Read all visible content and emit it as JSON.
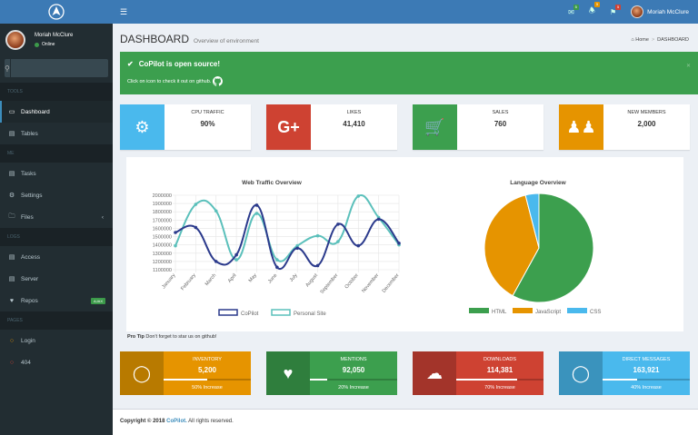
{
  "user": {
    "name": "Moriah McClure",
    "status": "Online"
  },
  "sidebar": {
    "search_placeholder": "",
    "sections": [
      {
        "header": "TOOLS",
        "items": [
          {
            "label": "Dashboard",
            "icon": "desktop-icon",
            "active": true
          },
          {
            "label": "Tables",
            "icon": "table-icon"
          }
        ]
      },
      {
        "header": "ME",
        "items": [
          {
            "label": "Tasks",
            "icon": "tasks-icon"
          },
          {
            "label": "Settings",
            "icon": "gear-icon"
          },
          {
            "label": "Files",
            "icon": "folder-icon",
            "chevron": "‹"
          }
        ]
      },
      {
        "header": "LOGS",
        "items": [
          {
            "label": "Access",
            "icon": "book-icon"
          },
          {
            "label": "Server",
            "icon": "server-icon"
          },
          {
            "label": "Repos",
            "icon": "heart-icon",
            "tag": "AJAX"
          }
        ]
      },
      {
        "header": "PAGES",
        "items": [
          {
            "label": "Login",
            "icon": "circle-icon",
            "color": "#e69400"
          },
          {
            "label": "404",
            "icon": "circle-icon",
            "color": "#d14234"
          }
        ]
      }
    ]
  },
  "topbar": {
    "badges": [
      {
        "icon": "envelope-icon",
        "count": "5",
        "color": "#3c9a4a"
      },
      {
        "icon": "bell-icon",
        "count": "5",
        "color": "#e69400"
      },
      {
        "icon": "flag-icon",
        "count": "5",
        "color": "#d14234"
      }
    ]
  },
  "header": {
    "title": "DASHBOARD",
    "subtitle": "Overview of environment",
    "breadcrumb": [
      "Home",
      "DASHBOARD"
    ]
  },
  "alert": {
    "title": "CoPilot is open source!",
    "text": "Click on icon to check it out on github."
  },
  "info_boxes": [
    {
      "label": "CPU TRAFFIC",
      "value": "90%",
      "color": "#4ab9ed",
      "icon": "gear-icon"
    },
    {
      "label": "LIKES",
      "value": "41,410",
      "color": "#ce4232",
      "icon": "google-plus-icon"
    },
    {
      "label": "SALES",
      "value": "760",
      "color": "#3c9f4e",
      "icon": "shopping-cart-icon"
    },
    {
      "label": "NEW MEMBERS",
      "value": "2,000",
      "color": "#e69400",
      "icon": "users-icon"
    }
  ],
  "chart_data": [
    {
      "type": "line",
      "title": "Web Traffic Overview",
      "categories": [
        "January",
        "February",
        "March",
        "April",
        "May",
        "June",
        "July",
        "August",
        "September",
        "October",
        "November",
        "December"
      ],
      "ylim": [
        1100000,
        2000000
      ],
      "yticks": [
        "2000000",
        "1900000",
        "1800000",
        "1700000",
        "1600000",
        "1500000",
        "1400000",
        "1300000",
        "1200000",
        "1100000"
      ],
      "grid": true,
      "legend": "bottom",
      "series": [
        {
          "name": "CoPilot",
          "color": "#2b3a8c",
          "values": [
            1550000,
            1610000,
            1200000,
            1280000,
            1880000,
            1130000,
            1360000,
            1150000,
            1650000,
            1390000,
            1710000,
            1420000
          ]
        },
        {
          "name": "Personal Site",
          "color": "#5bc0bb",
          "values": [
            1390000,
            1890000,
            1810000,
            1220000,
            1780000,
            1220000,
            1390000,
            1510000,
            1440000,
            1990000,
            1730000,
            1400000
          ]
        }
      ]
    },
    {
      "type": "pie",
      "title": "Language Overview",
      "legend": "bottom",
      "categories": [
        "HTML",
        "JavaScript",
        "CSS"
      ],
      "values": [
        58,
        38,
        4
      ],
      "colors": [
        "#3c9f4e",
        "#e69400",
        "#4ab9ed"
      ]
    }
  ],
  "protip": {
    "label": "Pro Tip",
    "text": "Don't forget to star us on github!"
  },
  "stat_boxes": [
    {
      "label": "INVENTORY",
      "value": "5,200",
      "desc": "50% Increase",
      "progress": 50,
      "color": "#e69400",
      "dark": "#b87a00",
      "icon": "tag-icon"
    },
    {
      "label": "MENTIONS",
      "value": "92,050",
      "desc": "20% Increase",
      "progress": 20,
      "color": "#3c9f4e",
      "dark": "#2f7e3d",
      "icon": "heart-icon"
    },
    {
      "label": "DOWNLOADS",
      "value": "114,381",
      "desc": "70% Increase",
      "progress": 70,
      "color": "#ce4232",
      "dark": "#a3342a",
      "icon": "cloud-download-icon"
    },
    {
      "label": "DIRECT MESSAGES",
      "value": "163,921",
      "desc": "40% Increase",
      "progress": 40,
      "color": "#4ab9ed",
      "dark": "#3a93bd",
      "icon": "comment-icon"
    }
  ],
  "footer": {
    "prefix": "Copyright © 2018 ",
    "brand": "CoPilot.",
    "suffix": " All rights reserved."
  }
}
